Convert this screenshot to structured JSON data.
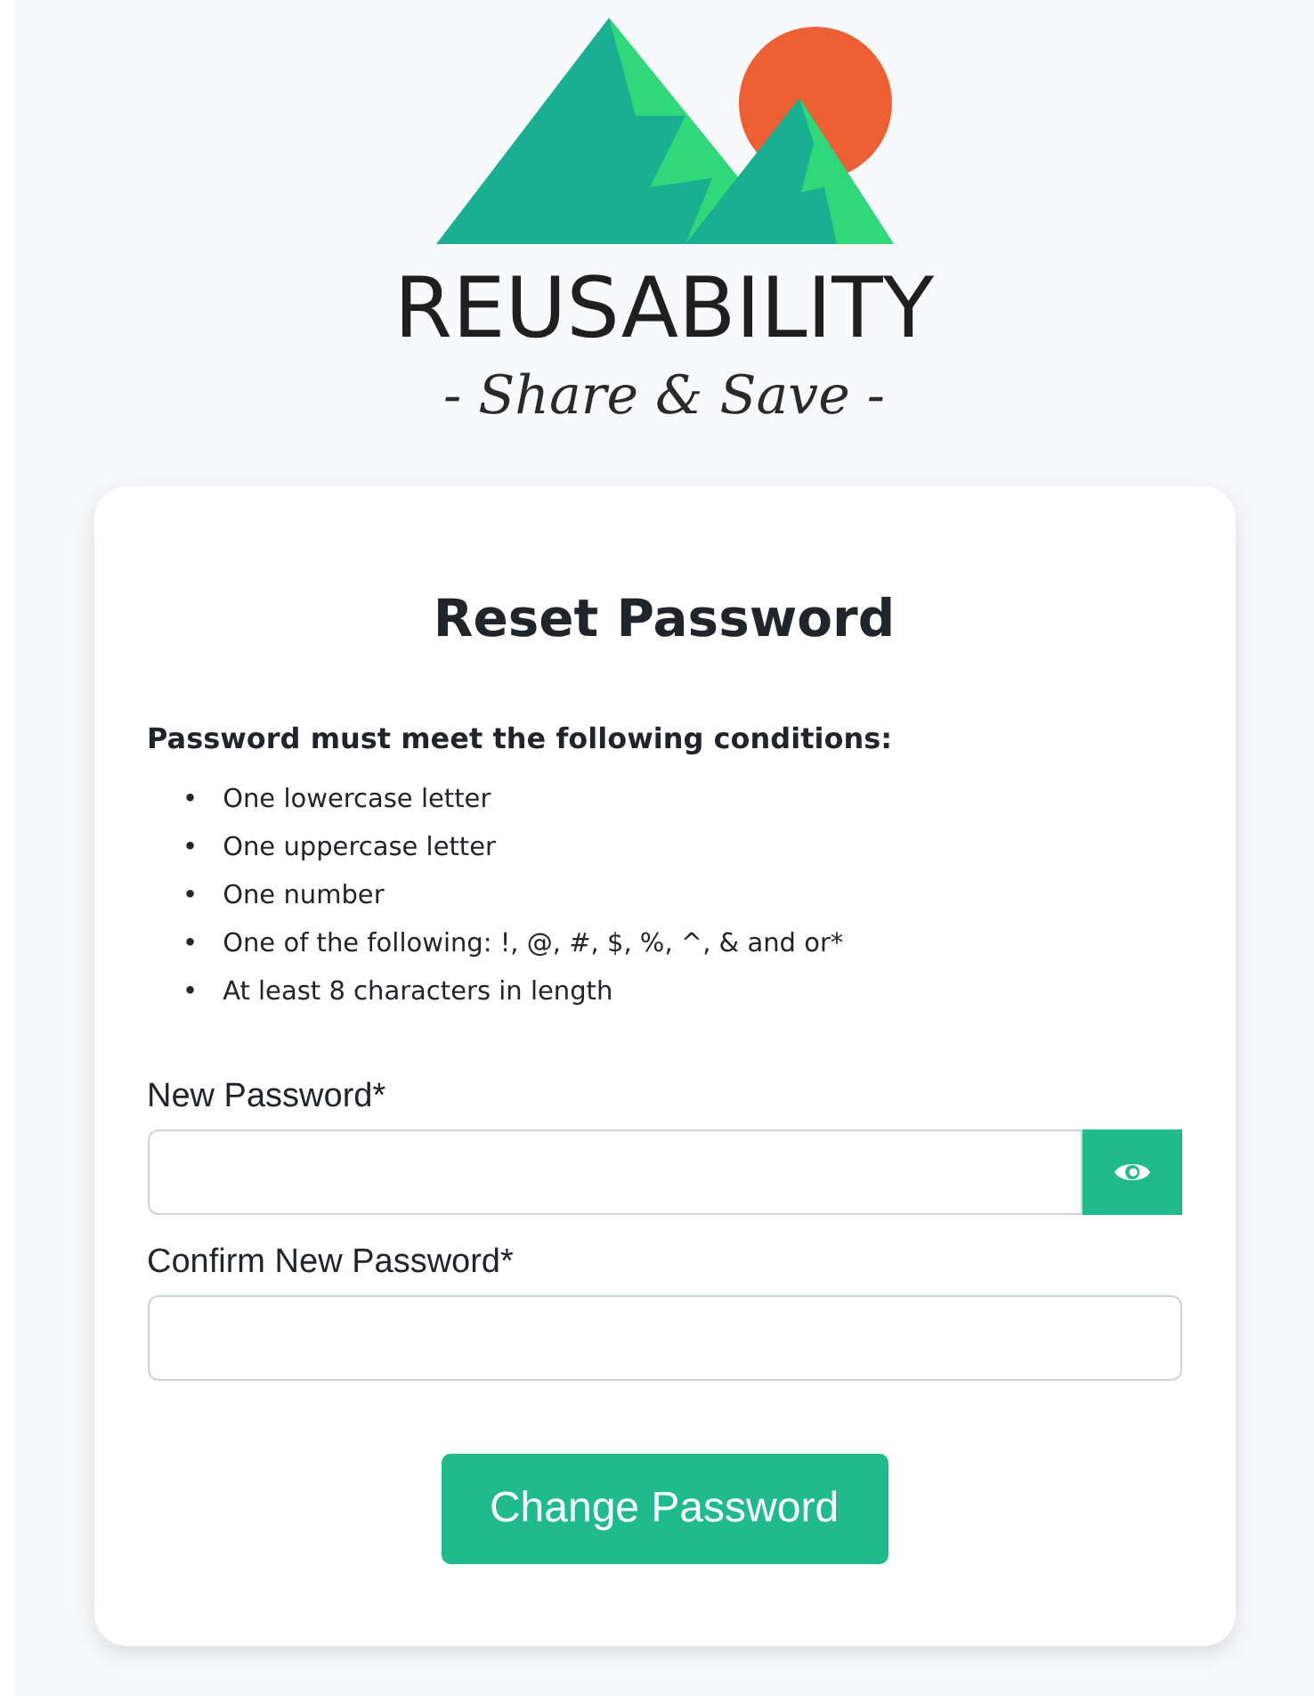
{
  "brand": {
    "name": "REUSABILITY",
    "tagline": "- Share & Save -"
  },
  "card": {
    "title": "Reset Password",
    "rules_heading": "Password must meet the following conditions:",
    "bullet": "•",
    "rules": [
      "One lowercase letter",
      "One uppercase letter",
      "One number",
      "One of the following: !, @, #, $, %, ^, & and or*",
      "At least 8 characters in length"
    ],
    "fields": [
      {
        "label": "New Password*",
        "reveal_button": true
      },
      {
        "label": "Confirm New Password*",
        "reveal_button": false
      }
    ],
    "submit": "Change Password"
  }
}
